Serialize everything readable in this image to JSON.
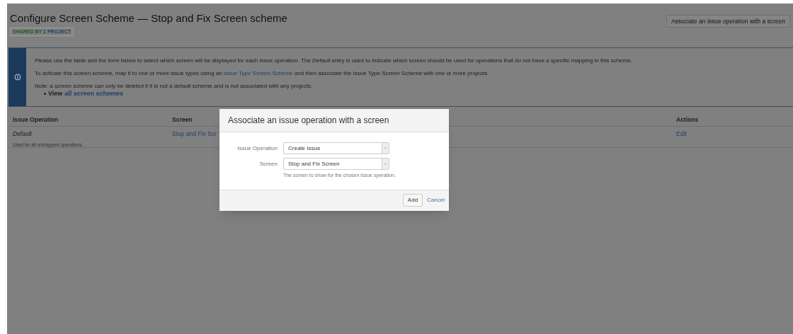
{
  "header": {
    "title": "Configure Screen Scheme — Stop and Fix Screen scheme",
    "badge": {
      "prefix": "SHARED BY",
      "count": "1",
      "suffix": "PROJECT"
    },
    "action_button": "Associate an issue operation with a screen"
  },
  "info": {
    "lines": [
      "Please use the table and the form below to select which screen will be displayed for each issue operation. The *Default* entry is used to indicate which screen should be used for operations that do not have a specific mapping in this scheme.",
      {
        "before": "To activate this screen scheme, map it to one or more issue types using an",
        "link": "Issue Type Screen Scheme",
        "after": "and then associate the Issue Type Screen Scheme with one or more projects."
      },
      "Note: a screen scheme can only be deleted if it is not a default scheme and is not associated with any projects."
    ],
    "bullet": {
      "label": "View",
      "link": "all screen schemes"
    }
  },
  "table": {
    "columns": [
      "Issue Operation",
      "Screen",
      "Actions"
    ],
    "rows": [
      {
        "operation": "Default",
        "note": "Used for all unmapped operations.",
        "screen": "Stop and Fix Scr",
        "action": "Edit"
      }
    ]
  },
  "dialog": {
    "title": "Associate an issue operation with a screen",
    "fields": [
      {
        "label": "Issue Operation",
        "value": "Create Issue"
      },
      {
        "label": "Screen",
        "value": "Stop and Fix Screen",
        "help": "The screen to show for the chosen issue operation."
      }
    ],
    "buttons": [
      {
        "kind": "button",
        "label": "Add"
      },
      {
        "kind": "link",
        "label": "Cancel"
      }
    ]
  }
}
